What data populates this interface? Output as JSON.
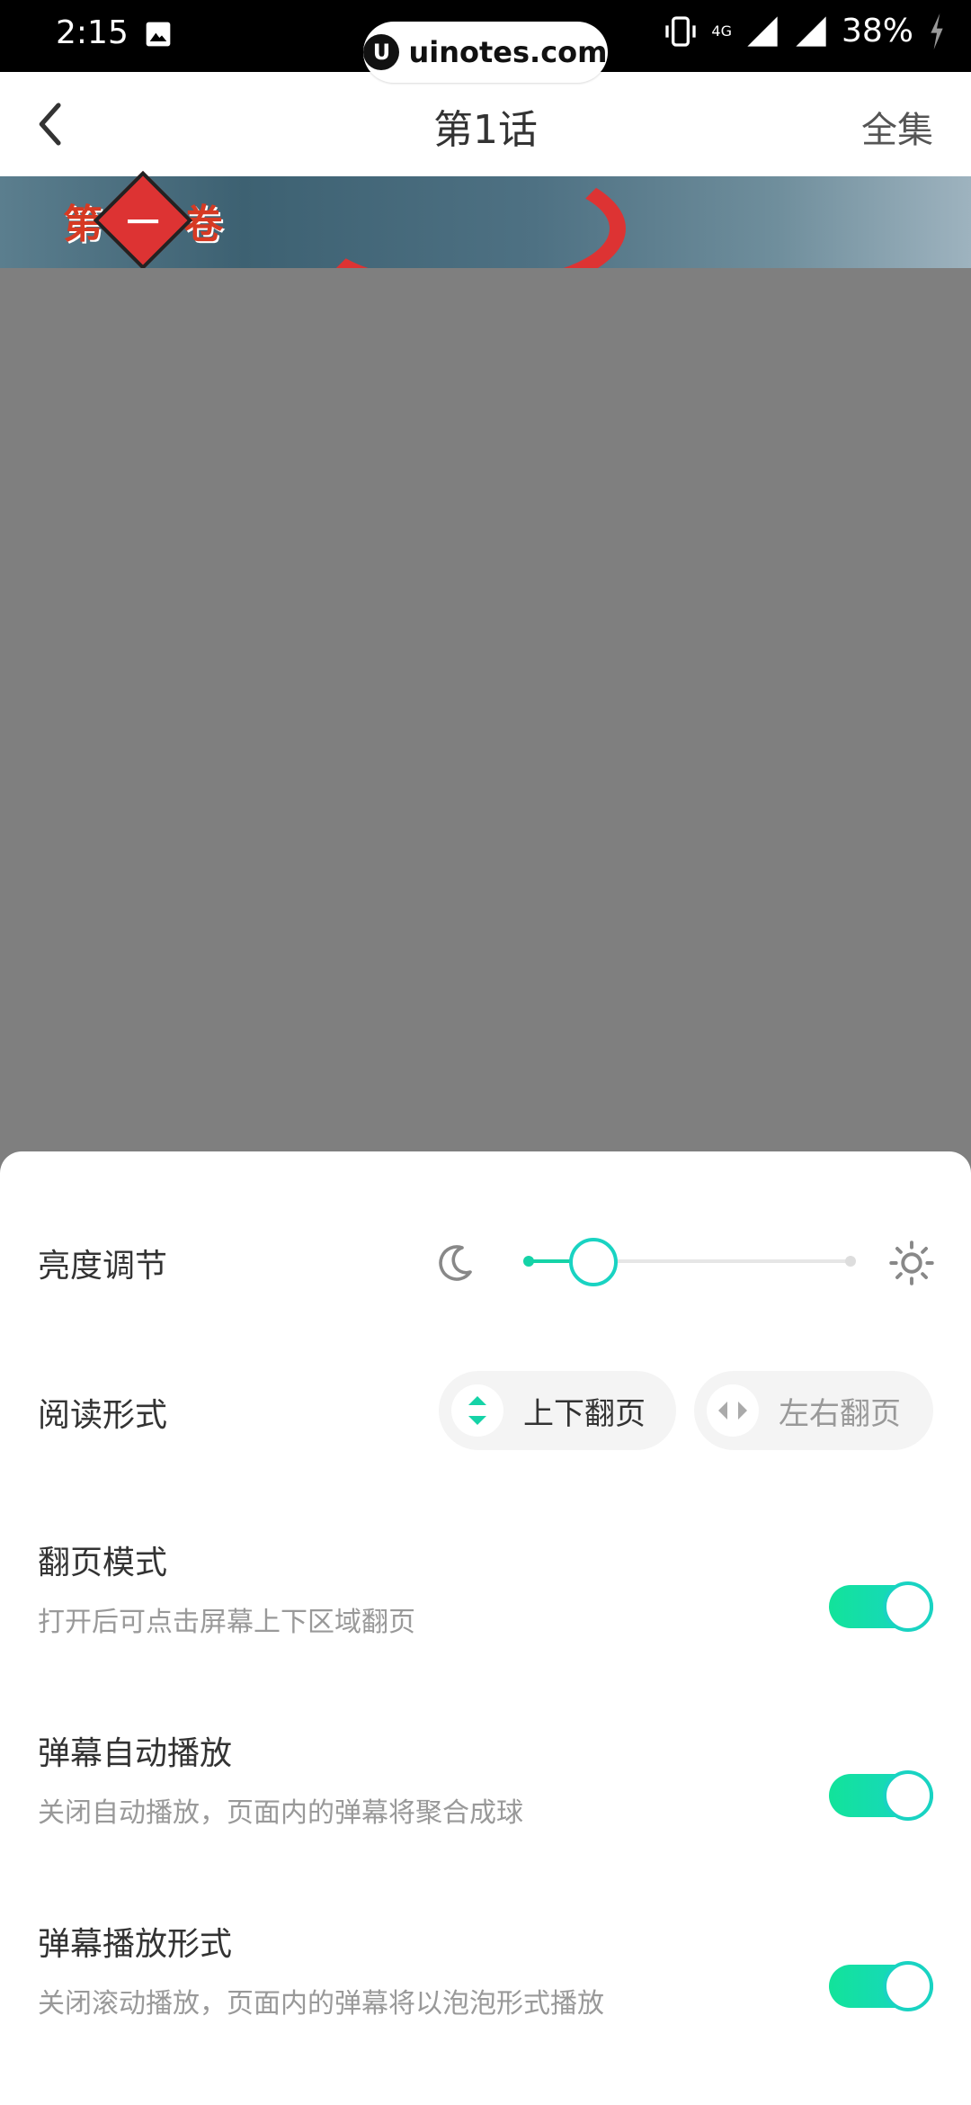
{
  "status_bar": {
    "time": "2:15",
    "network": "4G",
    "battery": "38%"
  },
  "watermark": {
    "text": "uinotes.com",
    "logo_letter": "U"
  },
  "header": {
    "title": "第1话",
    "right_label": "全集"
  },
  "banner": {
    "word_left": "第",
    "word_center": "一",
    "word_right": "卷"
  },
  "settings": {
    "brightness": {
      "label": "亮度调节",
      "level_percent": 20
    },
    "reading_form": {
      "label": "阅读形式",
      "options": [
        {
          "label": "上下翻页",
          "selected": true
        },
        {
          "label": "左右翻页",
          "selected": false
        }
      ]
    },
    "toggles": [
      {
        "label": "翻页模式",
        "description": "打开后可点击屏幕上下区域翻页",
        "on": true
      },
      {
        "label": "弹幕自动播放",
        "description": "关闭自动播放，页面内的弹幕将聚合成球",
        "on": true
      },
      {
        "label": "弹幕播放形式",
        "description": "关闭滚动播放，页面内的弹幕将以泡泡形式播放",
        "on": true
      }
    ]
  },
  "colors": {
    "accent": "#15d3a7",
    "accent_end": "#19d3c9"
  }
}
